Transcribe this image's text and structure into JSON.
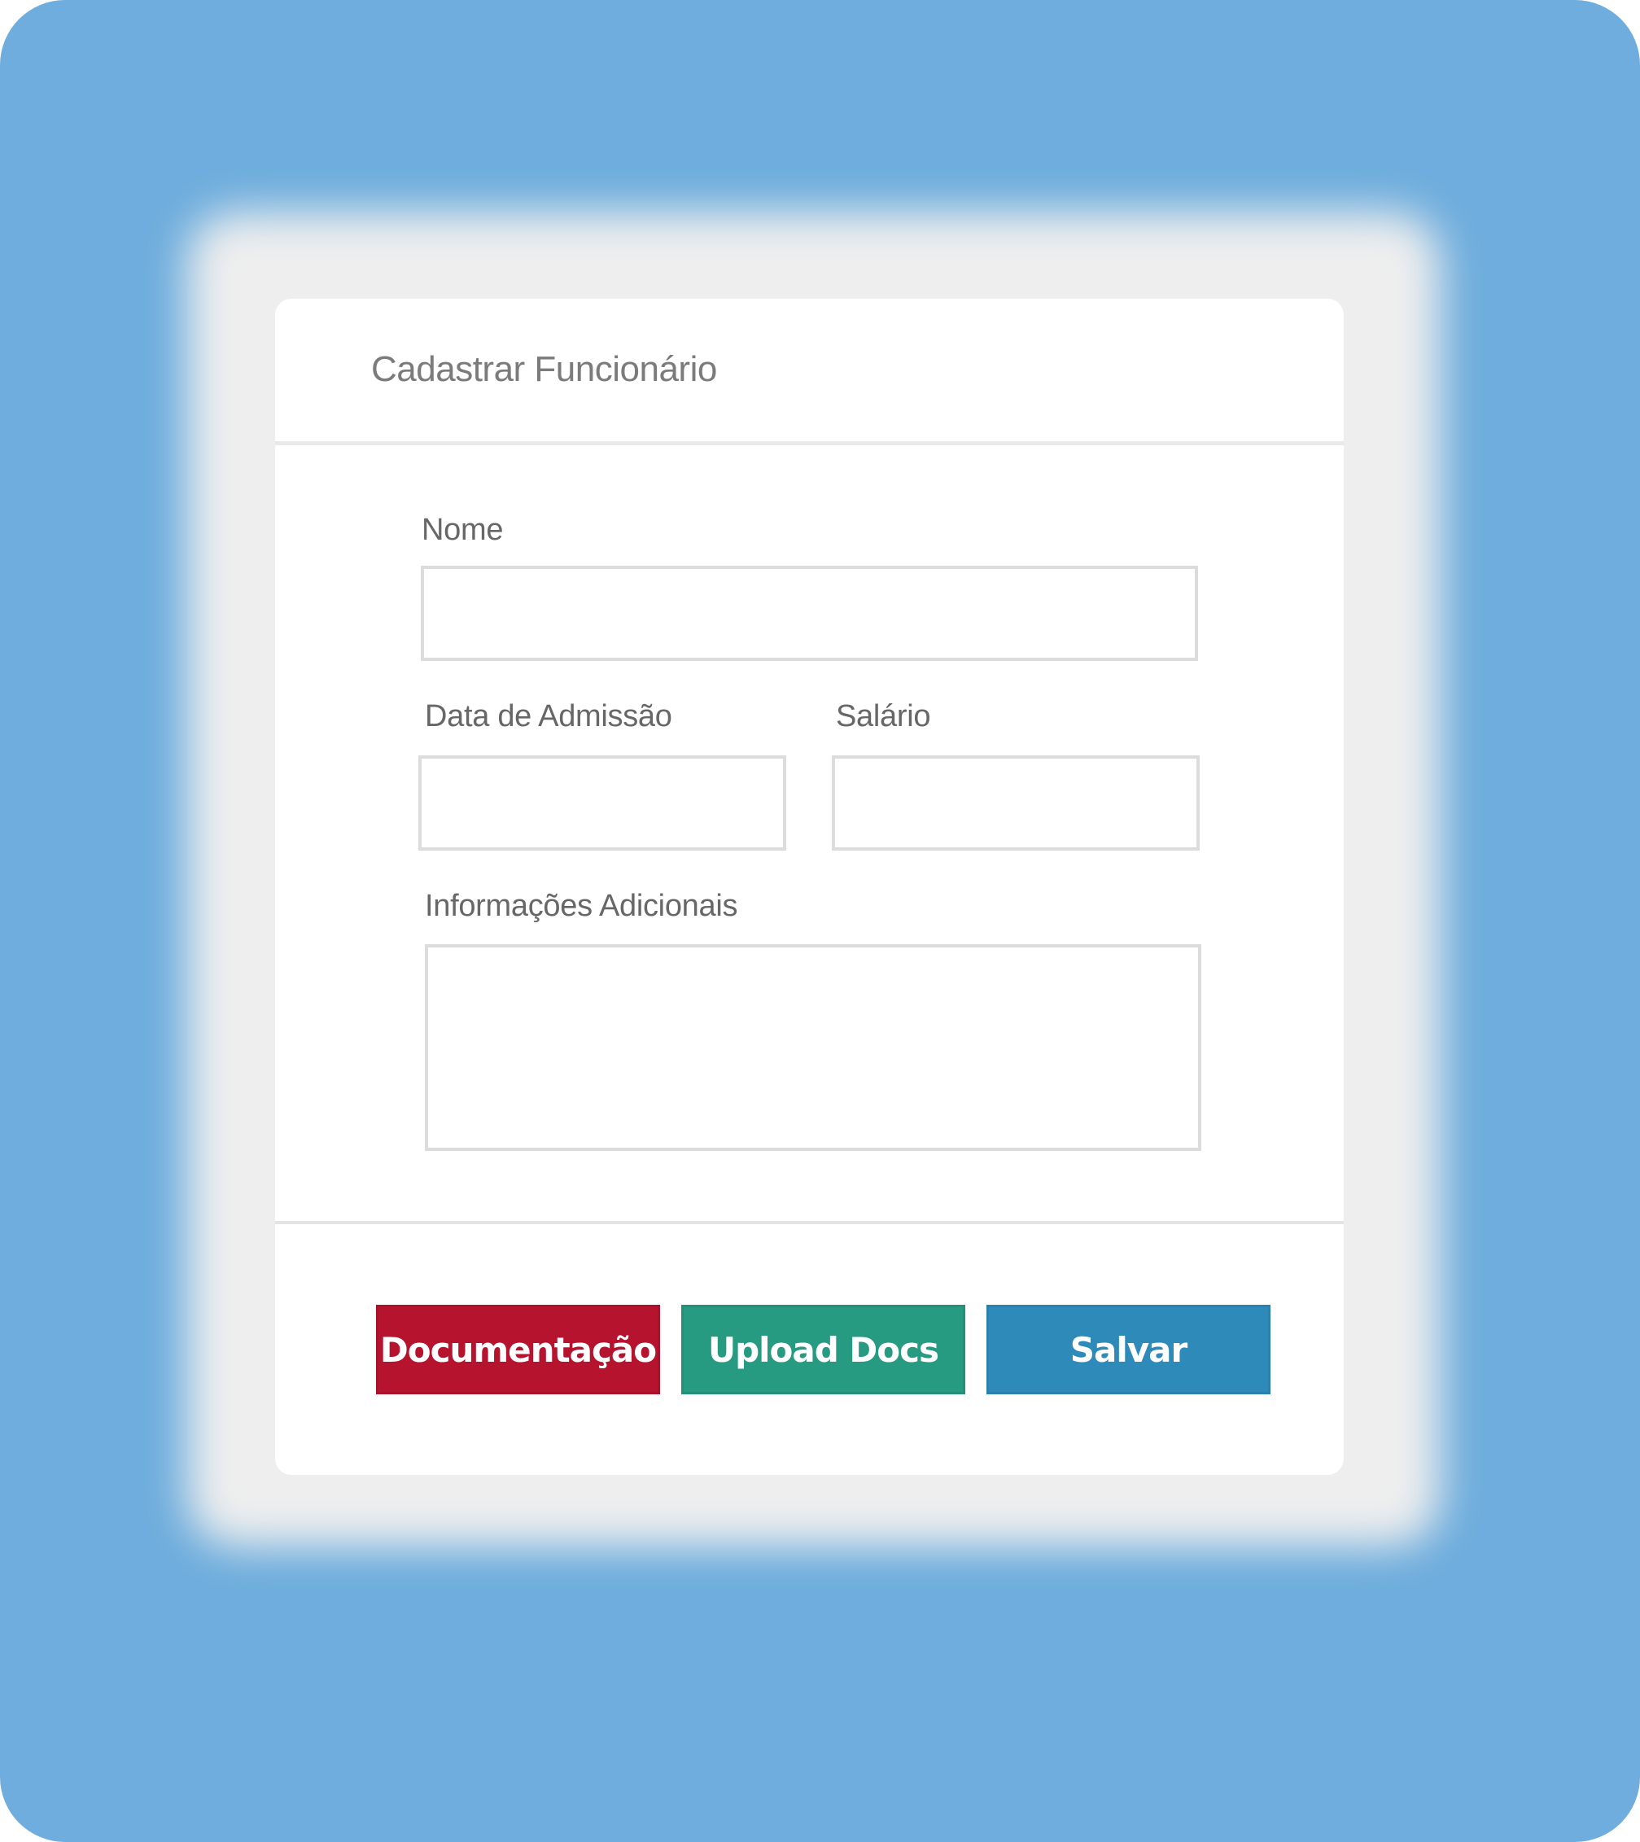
{
  "modal": {
    "title": "Cadastrar Funcionário"
  },
  "form": {
    "nome": {
      "label": "Nome",
      "value": "",
      "placeholder": ""
    },
    "data_admissao": {
      "label": "Data de Admissão",
      "value": "",
      "placeholder": ""
    },
    "salario": {
      "label": "Salário",
      "value": "",
      "placeholder": ""
    },
    "informacoes": {
      "label": "Informações Adicionais",
      "value": "",
      "placeholder": ""
    }
  },
  "buttons": {
    "documentacao": {
      "label": "Documentação",
      "color": "#b5132e"
    },
    "upload": {
      "label": "Upload Docs",
      "color": "#279a82"
    },
    "salvar": {
      "label": "Salvar",
      "color": "#2e8ab8"
    }
  },
  "colors": {
    "background": "#6eaddd",
    "modal": "#ffffff",
    "glow": "#eeeeee"
  }
}
